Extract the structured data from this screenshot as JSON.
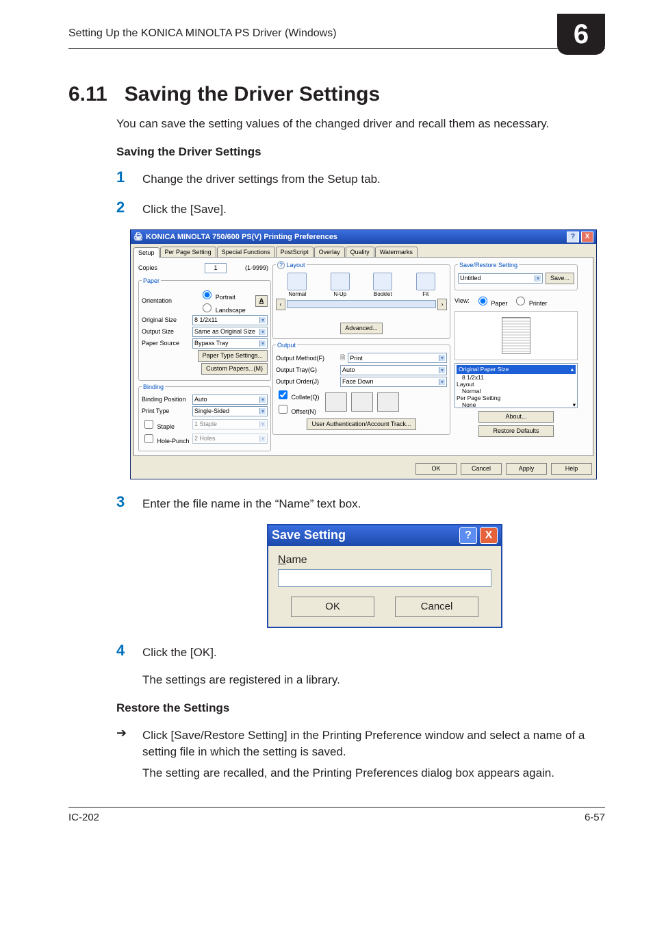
{
  "runningHeader": "Setting Up the KONICA MINOLTA PS Driver (Windows)",
  "chapterNumber": "6",
  "section": {
    "number": "6.11",
    "title": "Saving the Driver Settings"
  },
  "intro": "You can save the setting values of the changed driver and recall them as necessary.",
  "sub1": "Saving the Driver Settings",
  "steps": {
    "s1": {
      "num": "1",
      "text": "Change the driver settings from the Setup tab."
    },
    "s2": {
      "num": "2",
      "text": "Click the [Save]."
    },
    "s3": {
      "num": "3",
      "text": "Enter the file name in the “Name” text box."
    },
    "s4": {
      "num": "4",
      "text": "Click the [OK]."
    }
  },
  "afterOk": "The settings are registered in a library.",
  "sub2": "Restore the Settings",
  "restore": {
    "line1": "Click [Save/Restore Setting] in the Printing Preference window and select a name of a setting file in which the setting is saved.",
    "line2": "The setting are recalled, and the Printing Preferences dialog box appears again."
  },
  "footer": {
    "left": "IC-202",
    "right": "6-57"
  },
  "prefs": {
    "title": "KONICA MINOLTA 750/600 PS(V) Printing Preferences",
    "helpGlyph": "?",
    "closeGlyph": "X",
    "tabs": [
      "Setup",
      "Per Page Setting",
      "Special Functions",
      "PostScript",
      "Overlay",
      "Quality",
      "Watermarks"
    ],
    "activeTab": 0,
    "left": {
      "copiesLabel": "Copies",
      "copiesValue": "1",
      "copiesRange": "(1-9999)",
      "group_paper": "Paper",
      "orientationLabel": "Orientation",
      "orientationPortrait": "Portrait",
      "orientationLandscape": "Landscape",
      "aButton": "A",
      "originalSizeLabel": "Original Size",
      "originalSizeValue": "8 1/2x11",
      "outputSizeLabel": "Output Size",
      "outputSizeValue": "Same as Original Size",
      "paperSourceLabel": "Paper Source",
      "paperSourceValue": "Bypass Tray",
      "paperTypeBtn": "Paper Type Settings...",
      "customPapersBtn": "Custom Papers...(M)",
      "group_binding": "Binding",
      "bindingPosLabel": "Binding Position",
      "bindingPosValue": "Auto",
      "printTypeLabel": "Print Type",
      "printTypeValue": "Single-Sided",
      "stapleLabel": "Staple",
      "stapleValue": "1 Staple",
      "holePunchLabel": "Hole-Punch",
      "holePunchValue": "2 Holes"
    },
    "middle": {
      "group_layout": "Layout",
      "layoutHelp": "?",
      "layoutItems": [
        "Normal",
        "N-Up",
        "Booklet",
        "Fit"
      ],
      "advancedBtn": "Advanced...",
      "group_output": "Output",
      "outputMethodLabel": "Output Method(F)",
      "outputMethodValue": "Print",
      "outputTrayLabel": "Output Tray(G)",
      "outputTrayValue": "Auto",
      "outputOrderLabel": "Output Order(J)",
      "outputOrderValue": "Face Down",
      "collateLabel": "Collate(Q)",
      "offsetLabel": "Offset(N)",
      "userAuthBtn": "User Authentication/Account Track..."
    },
    "right": {
      "group_save": "Save/Restore Setting",
      "settingValue": "Untitled",
      "saveBtn": "Save...",
      "viewLabel": "View:",
      "viewPaper": "Paper",
      "viewPrinter": "Printer",
      "summary": {
        "header": "Original Paper Size",
        "rows": {
          "r0": "8 1/2x11",
          "r1l": "Layout",
          "r1": "Normal",
          "r2l": "Per Page Setting",
          "r2": "None"
        }
      },
      "aboutBtn": "About...",
      "restoreBtn": "Restore Defaults"
    },
    "footer": {
      "ok": "OK",
      "cancel": "Cancel",
      "apply": "Apply",
      "help": "Help"
    }
  },
  "saveDlg": {
    "title": "Save Setting",
    "helpGlyph": "?",
    "closeGlyph": "X",
    "nameAccel": "N",
    "nameRest": "ame",
    "ok": "OK",
    "cancel": "Cancel"
  }
}
